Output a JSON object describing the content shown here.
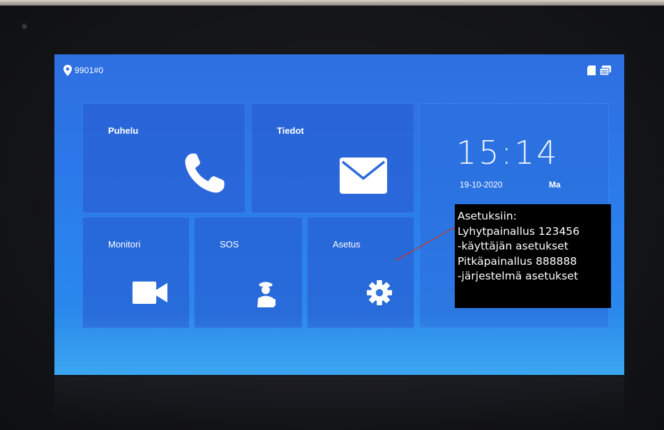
{
  "status_bar": {
    "room_id": "9901#0",
    "icons": [
      "location-pin-icon",
      "sd-card-icon",
      "network-icon"
    ]
  },
  "tiles": {
    "puhelu": {
      "label": "Puhelu",
      "icon": "phone-icon"
    },
    "tiedot": {
      "label": "Tiedot",
      "icon": "envelope-icon"
    },
    "monitori": {
      "label": "Monitori",
      "icon": "video-camera-icon"
    },
    "sos": {
      "label": "SOS",
      "icon": "guard-icon"
    },
    "asetus": {
      "label": "Asetus",
      "icon": "gear-icon"
    }
  },
  "clock": {
    "time": "15:14",
    "date": "19-10-2020",
    "day": "Ma"
  },
  "annotation": {
    "lines": [
      "Asetuksiin:",
      "Lyhytpainallus 123456",
      "-käyttäjän asetukset",
      "Pitkäpainallus 888888",
      "-järjestelmä asetukset"
    ]
  },
  "colors": {
    "screen_blue": "#2b78ea",
    "tile_blue": "#285fd2",
    "annotation_bg": "#000000",
    "pointer_line": "#c0392b"
  }
}
